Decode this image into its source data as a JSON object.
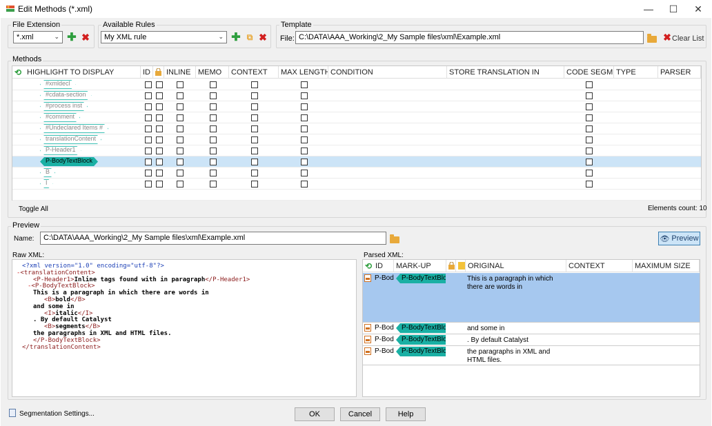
{
  "window": {
    "title": "Edit Methods (*.xml)"
  },
  "file_extension": {
    "legend": "File Extension",
    "value": "*.xml"
  },
  "available_rules": {
    "legend": "Available Rules",
    "value": "My XML rule"
  },
  "template": {
    "legend": "Template",
    "file_label": "File:",
    "file_value": "C:\\DATA\\AAA_Working\\2_My Sample files\\xml\\Example.xml",
    "clear_list": "Clear List"
  },
  "methods": {
    "legend": "Methods",
    "columns": [
      "HIGHLIGHT TO DISPLAY",
      "ID",
      "INLINE",
      "MEMO",
      "CONTEXT",
      "MAX LENGTH",
      "CONDITION",
      "STORE TRANSLATION IN",
      "CODE SEGMENT",
      "TYPE",
      "PARSER"
    ],
    "rows": [
      {
        "tag": "#xmldecl",
        "filled": false
      },
      {
        "tag": "#cdata-section",
        "filled": false
      },
      {
        "tag": "#process inst",
        "filled": false
      },
      {
        "tag": "#comment",
        "filled": false
      },
      {
        "tag": "#Undeclared Items #",
        "filled": false
      },
      {
        "tag": "translationContent",
        "filled": false
      },
      {
        "tag": "P-Header1",
        "filled": false
      },
      {
        "tag": "P-BodyTextBlock",
        "filled": true
      },
      {
        "tag": "B",
        "filled": false
      },
      {
        "tag": "I",
        "filled": false
      }
    ],
    "toggle_all": "Toggle All",
    "elements_count": "Elements count: 10"
  },
  "preview": {
    "legend": "Preview",
    "name_label": "Name:",
    "name_value": "C:\\DATA\\AAA_Working\\2_My Sample files\\xml\\Example.xml",
    "preview_button": "Preview",
    "raw_label": "Raw XML:",
    "parsed_label": "Parsed XML:",
    "raw_lines": [
      {
        "indent": 0,
        "minus": "",
        "parts": [
          {
            "t": "<?xml version=\"1.0\" encoding=\"utf-8\"?>",
            "c": "bl"
          }
        ]
      },
      {
        "indent": 0,
        "minus": "-",
        "parts": [
          {
            "t": "<translationContent>",
            "c": "br"
          }
        ]
      },
      {
        "indent": 1,
        "minus": "",
        "parts": [
          {
            "t": "<P-Header1>",
            "c": "br"
          },
          {
            "t": "Inline tags found with in paragraph",
            "c": "bo"
          },
          {
            "t": "</P-Header1>",
            "c": "br"
          }
        ]
      },
      {
        "indent": 1,
        "minus": "-",
        "parts": [
          {
            "t": "<P-BodyTextBlock>",
            "c": "br"
          }
        ]
      },
      {
        "indent": 1,
        "minus": "",
        "parts": [
          {
            "t": "This is a paragraph in which there are words in",
            "c": "bo"
          }
        ]
      },
      {
        "indent": 2,
        "minus": "",
        "parts": [
          {
            "t": "<B>",
            "c": "br"
          },
          {
            "t": "bold",
            "c": "bo"
          },
          {
            "t": "</B>",
            "c": "br"
          }
        ]
      },
      {
        "indent": 1,
        "minus": "",
        "parts": [
          {
            "t": "and some in",
            "c": "bo"
          }
        ]
      },
      {
        "indent": 2,
        "minus": "",
        "parts": [
          {
            "t": "<I>",
            "c": "br"
          },
          {
            "t": "italic",
            "c": "bo"
          },
          {
            "t": "</I>",
            "c": "br"
          }
        ]
      },
      {
        "indent": 1,
        "minus": "",
        "parts": [
          {
            "t": ". By default Catalyst",
            "c": "bo"
          }
        ]
      },
      {
        "indent": 2,
        "minus": "",
        "parts": [
          {
            "t": "<B>",
            "c": "br"
          },
          {
            "t": "segments",
            "c": "bo"
          },
          {
            "t": "</B>",
            "c": "br"
          }
        ]
      },
      {
        "indent": 1,
        "minus": "",
        "parts": [
          {
            "t": "the paragraphs in XML and HTML files.",
            "c": "bo"
          }
        ]
      },
      {
        "indent": 1,
        "minus": "",
        "parts": [
          {
            "t": "</P-BodyTextBlock>",
            "c": "br"
          }
        ]
      },
      {
        "indent": 0,
        "minus": "",
        "parts": [
          {
            "t": "</translationContent>",
            "c": "br"
          }
        ]
      }
    ],
    "parsed_columns": [
      "ID",
      "MARK-UP",
      "ORIGINAL",
      "CONTEXT",
      "MAXIMUM SIZE"
    ],
    "parsed_rows": [
      {
        "id": "P-Bod",
        "markup": "P-BodyTextBlock",
        "original": "This is a paragraph in which there are words in",
        "selected": true
      },
      {
        "id": "P-Bod",
        "markup": "P-BodyTextBlock",
        "original": "and some in",
        "selected": false
      },
      {
        "id": "P-Bod",
        "markup": "P-BodyTextBlock",
        "original": ". By default Catalyst",
        "selected": false
      },
      {
        "id": "P-Bod",
        "markup": "P-BodyTextBlock",
        "original": "the paragraphs in XML and HTML files.",
        "selected": false
      }
    ]
  },
  "footer": {
    "segmentation": "Segmentation Settings...",
    "ok": "OK",
    "cancel": "Cancel",
    "help": "Help"
  }
}
